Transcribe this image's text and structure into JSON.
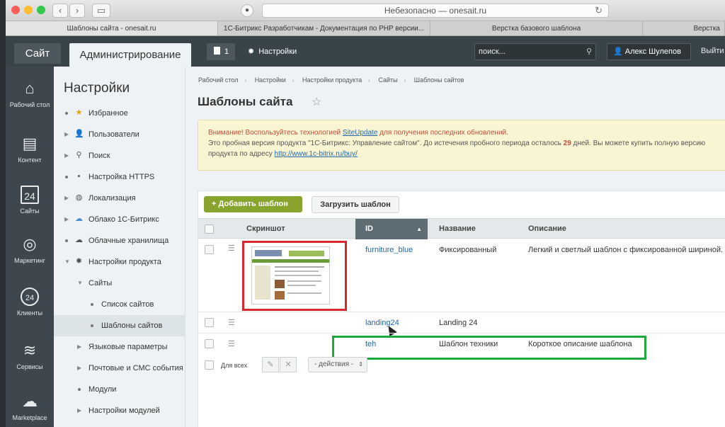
{
  "browser": {
    "url": "Небезопасно — onesait.ru",
    "tabs": [
      "Шаблоны сайта - onesait.ru",
      "1С-Битрикс Разработчикам - Документация по PHP версии...",
      "Верстка базового шаблона",
      "Верстка"
    ]
  },
  "header": {
    "site_btn": "Сайт",
    "admin_btn": "Администрирование",
    "notif_count": "1",
    "settings": "Настройки",
    "search_placeholder": "поиск...",
    "user": "Алекс Шулепов",
    "exit": "Выйти"
  },
  "left_menu": [
    {
      "label": "Рабочий стол",
      "icon": "home-icon"
    },
    {
      "label": "Контент",
      "icon": "document-icon"
    },
    {
      "label": "Сайты",
      "icon": "calendar-icon"
    },
    {
      "label": "Маркетинг",
      "icon": "target-icon"
    },
    {
      "label": "Клиенты",
      "icon": "clock24-icon"
    },
    {
      "label": "Сервисы",
      "icon": "layers-icon"
    },
    {
      "label": "Marketplace",
      "icon": "cloud-icon"
    }
  ],
  "submenu": {
    "title": "Настройки",
    "items": [
      "Избранное",
      "Пользователи",
      "Поиск",
      "Настройка HTTPS",
      "Локализация",
      "Облако 1С-Битрикс",
      "Облачные хранилища",
      "Настройки продукта",
      "Сайты",
      "Список сайтов",
      "Шаблоны сайтов",
      "Языковые параметры",
      "Почтовые и СМС события",
      "Модули",
      "Настройки модулей"
    ]
  },
  "breadcrumbs": [
    "Рабочий стол",
    "Настройки",
    "Настройки продукта",
    "Сайты",
    "Шаблоны сайтов"
  ],
  "page_title": "Шаблоны сайта",
  "notice": {
    "warn_prefix": "Внимание! Воспользуйтесь технологией ",
    "warn_link": "SiteUpdate",
    "warn_suffix": " для получения последних обновлений.",
    "line2_a": "Это пробная версия продукта \"1С-Битрикс: Управление сайтом\". До истечения пробного периода осталось ",
    "days": "29",
    "line2_b": " дней. Вы можете купить полную версию",
    "line3_a": "продукта по адресу ",
    "line3_link": "http://www.1c-bitrix.ru/buy/"
  },
  "toolbar": {
    "add": "Добавить шаблон",
    "load": "Загрузить шаблон"
  },
  "grid": {
    "headers": {
      "screenshot": "Скриншот",
      "id": "ID",
      "name": "Название",
      "desc": "Описание"
    },
    "rows": [
      {
        "id": "furniture_blue",
        "name": "Фиксированный",
        "desc": "Легкий и светлый шаблон с фиксированной шириной."
      },
      {
        "id": "landing24",
        "name": "Landing 24",
        "desc": ""
      },
      {
        "id": "teh",
        "name": "Шаблон техники",
        "desc": "Короткое описание шаблона"
      }
    ],
    "footer": {
      "for_all": "Для всех",
      "actions": "- действия -"
    }
  },
  "colors": {
    "accent_green": "#89a42d",
    "highlight_red": "#d7282f",
    "highlight_green": "#1ea83c",
    "link": "#2067b0"
  }
}
